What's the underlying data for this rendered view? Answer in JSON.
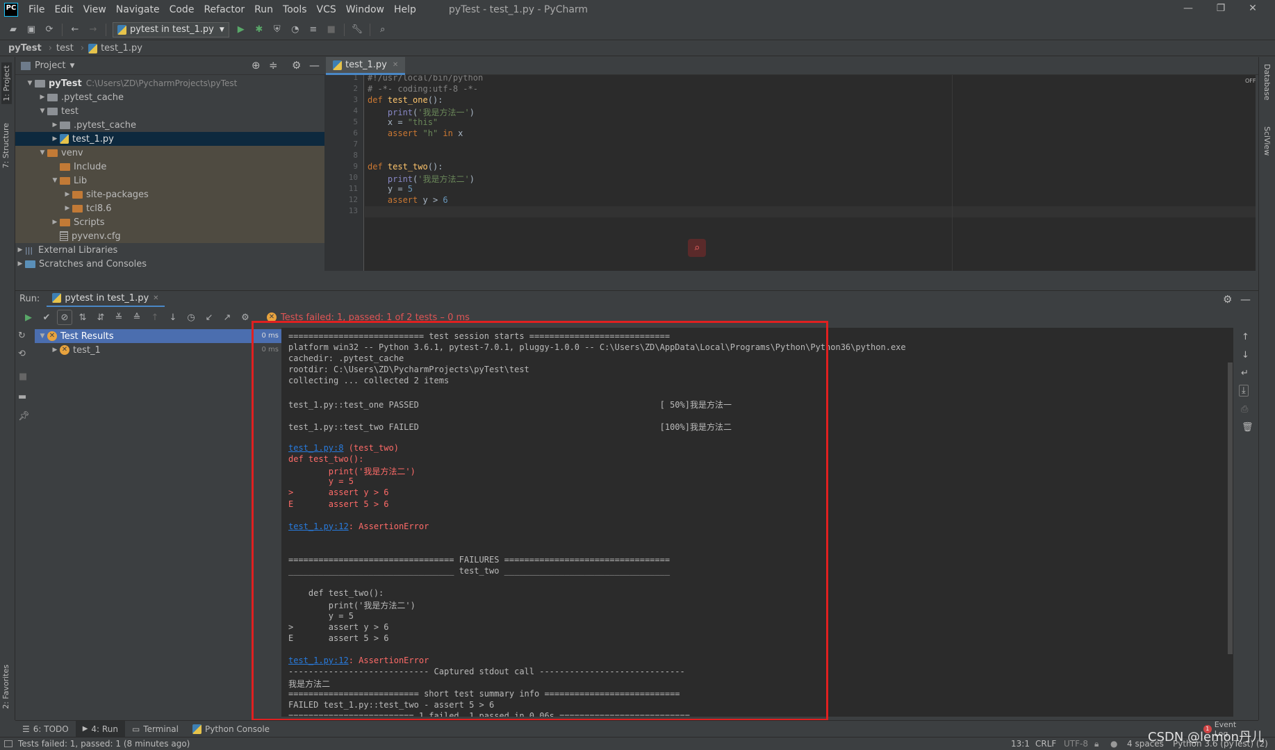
{
  "menu": [
    "File",
    "Edit",
    "View",
    "Navigate",
    "Code",
    "Refactor",
    "Run",
    "Tools",
    "VCS",
    "Window",
    "Help"
  ],
  "window_title": "pyTest - test_1.py - PyCharm",
  "app_logo": "PC",
  "toolbar": {
    "run_config": "pytest in test_1.py"
  },
  "breadcrumb": [
    "pyTest",
    "test",
    "test_1.py"
  ],
  "left_strip": {
    "project": "1: Project",
    "structure": "7: Structure",
    "favorites": "2: Favorites"
  },
  "right_strip": {
    "database": "Database",
    "sciview": "SciView"
  },
  "project": {
    "title": "Project",
    "tree": [
      {
        "label": "pyTest",
        "path": "C:\\Users\\ZD\\PycharmProjects\\pyTest"
      },
      {
        "label": ".pytest_cache"
      },
      {
        "label": "test"
      },
      {
        "label": ".pytest_cache"
      },
      {
        "label": "test_1.py"
      },
      {
        "label": "venv"
      },
      {
        "label": "Include"
      },
      {
        "label": "Lib"
      },
      {
        "label": "site-packages"
      },
      {
        "label": "tcl8.6"
      },
      {
        "label": "Scripts"
      },
      {
        "label": "pyvenv.cfg"
      },
      {
        "label": "External Libraries"
      },
      {
        "label": "Scratches and Consoles"
      }
    ]
  },
  "editor": {
    "tab": "test_1.py",
    "lines": [
      {
        "n": "1",
        "t": "#!/usr/local/bin/python"
      },
      {
        "n": "2",
        "t": "# -*- coding:utf-8 -*-"
      },
      {
        "n": "3",
        "t": "def test_one():"
      },
      {
        "n": "4",
        "t": "    print('我是方法一')"
      },
      {
        "n": "5",
        "t": "    x = \"this\""
      },
      {
        "n": "6",
        "t": "    assert \"h\" in x"
      },
      {
        "n": "7",
        "t": ""
      },
      {
        "n": "8",
        "t": ""
      },
      {
        "n": "9",
        "t": "def test_two():"
      },
      {
        "n": "10",
        "t": "    print('我是方法二')"
      },
      {
        "n": "11",
        "t": "    y = 5"
      },
      {
        "n": "12",
        "t": "    assert y > 6"
      },
      {
        "n": "13",
        "t": ""
      }
    ],
    "off_label": "OFF"
  },
  "run": {
    "label": "Run:",
    "tab": "pytest in test_1.py",
    "status": "Tests failed: 1, passed: 1 of 2 tests – 0 ms",
    "results": [
      {
        "label": "Test Results",
        "time": "0 ms"
      },
      {
        "label": "test_1",
        "time": "0 ms"
      }
    ]
  },
  "console": [
    {
      "t": "=========================== test session starts ============================",
      "c": ""
    },
    {
      "t": "platform win32 -- Python 3.6.1, pytest-7.0.1, pluggy-1.0.0 -- C:\\Users\\ZD\\AppData\\Local\\Programs\\Python\\Python36\\python.exe",
      "c": ""
    },
    {
      "t": "cachedir: .pytest_cache",
      "c": ""
    },
    {
      "t": "rootdir: C:\\Users\\ZD\\PycharmProjects\\pyTest\\test",
      "c": ""
    },
    {
      "t": "collecting ... collected 2 items",
      "c": ""
    },
    {
      "t": "",
      "c": ""
    },
    {
      "t": "test_1.py::test_one PASSED                                                [ 50%]我是方法一",
      "c": ""
    },
    {
      "t": "",
      "c": ""
    },
    {
      "t": "test_1.py::test_two FAILED                                                [100%]我是方法二",
      "c": ""
    },
    {
      "t": "",
      "c": ""
    },
    {
      "t": "test_1.py:8",
      "c": "link",
      "suffix": " (test_two)"
    },
    {
      "t": "def test_two():",
      "c": "red"
    },
    {
      "t": "        print('我是方法二')",
      "c": "red"
    },
    {
      "t": "        y = 5",
      "c": "red"
    },
    {
      "t": ">       assert y > 6",
      "c": "red"
    },
    {
      "t": "E       assert 5 > 6",
      "c": "red"
    },
    {
      "t": "",
      "c": ""
    },
    {
      "t": "test_1.py:12",
      "c": "link",
      "suffix": ": AssertionError"
    },
    {
      "t": "",
      "c": ""
    },
    {
      "t": "",
      "c": ""
    },
    {
      "t": "================================= FAILURES =================================",
      "c": ""
    },
    {
      "t": "_________________________________ test_two _________________________________",
      "c": ""
    },
    {
      "t": "",
      "c": ""
    },
    {
      "t": "    def test_two():",
      "c": ""
    },
    {
      "t": "        print('我是方法二')",
      "c": ""
    },
    {
      "t": "        y = 5",
      "c": ""
    },
    {
      "t": ">       assert y > 6",
      "c": ""
    },
    {
      "t": "E       assert 5 > 6",
      "c": ""
    },
    {
      "t": "",
      "c": ""
    },
    {
      "t": "test_1.py:12",
      "c": "link",
      "suffix": ": AssertionError"
    },
    {
      "t": "---------------------------- Captured stdout call -----------------------------",
      "c": ""
    },
    {
      "t": "我是方法二",
      "c": ""
    },
    {
      "t": "========================== short test summary info ===========================",
      "c": ""
    },
    {
      "t": "FAILED test_1.py::test_two - assert 5 > 6",
      "c": ""
    },
    {
      "t": "========================= 1 failed, 1 passed in 0.06s ==========================",
      "c": ""
    }
  ],
  "bottom_tabs": [
    "6: TODO",
    "4: Run",
    "Terminal",
    "Python Console"
  ],
  "event_log": {
    "badge": "1",
    "label": "Event Log"
  },
  "status": {
    "left": "Tests failed: 1, passed: 1 (8 minutes ago)",
    "position": "13:1",
    "line_sep": "CRLF",
    "encoding": "UTF-8",
    "indent": "4 spaces",
    "interpreter": "Python 3.6 (pyTest) (2)"
  },
  "watermark": "CSDN @lemon丹儿",
  "colors": {
    "accent": "#4a88c7",
    "error": "#e02020",
    "link": "#287bde"
  }
}
